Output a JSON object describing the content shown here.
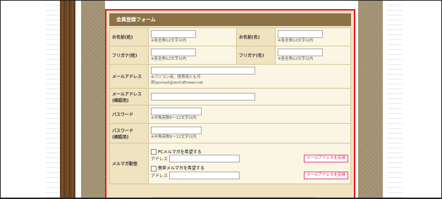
{
  "form": {
    "title": "会員登録フォーム",
    "rows": {
      "name_sei": {
        "label": "お名前(姓)",
        "note": "※各全角12文字以内"
      },
      "name_mei": {
        "label": "お名前(名)",
        "note": "※各全角12文字以内"
      },
      "kana_sei": {
        "label": "フリガナ(姓)",
        "note": "※各全角12文字以内"
      },
      "kana_mei": {
        "label": "フリガナ(名)",
        "note": "※各全角12文字以内"
      },
      "email": {
        "label": "メールアドレス",
        "note1": "※パソコン用、携帯用とも可",
        "note2": "例)pomail@worldflower.net"
      },
      "email_confirm": {
        "label1": "メールアドレス",
        "label2": "(確認用)"
      },
      "password": {
        "label": "パスワード",
        "note": "※半角英数6～12文字以内"
      },
      "password_confirm": {
        "label1": "パスワード",
        "label2": "(確認用)",
        "note": "※半角英数6～12文字以内"
      },
      "magazine": {
        "label": "メルマガ配信",
        "pc_check": "PCメルマガを希望する",
        "mobile_check": "携帯メルマガを希望する",
        "address_label": "アドレス",
        "button": "メールアドレスを反映"
      }
    }
  },
  "colors": {
    "titlebar": "#8b7347",
    "border_red": "#e8141b",
    "pink_button": "#e0437b"
  }
}
